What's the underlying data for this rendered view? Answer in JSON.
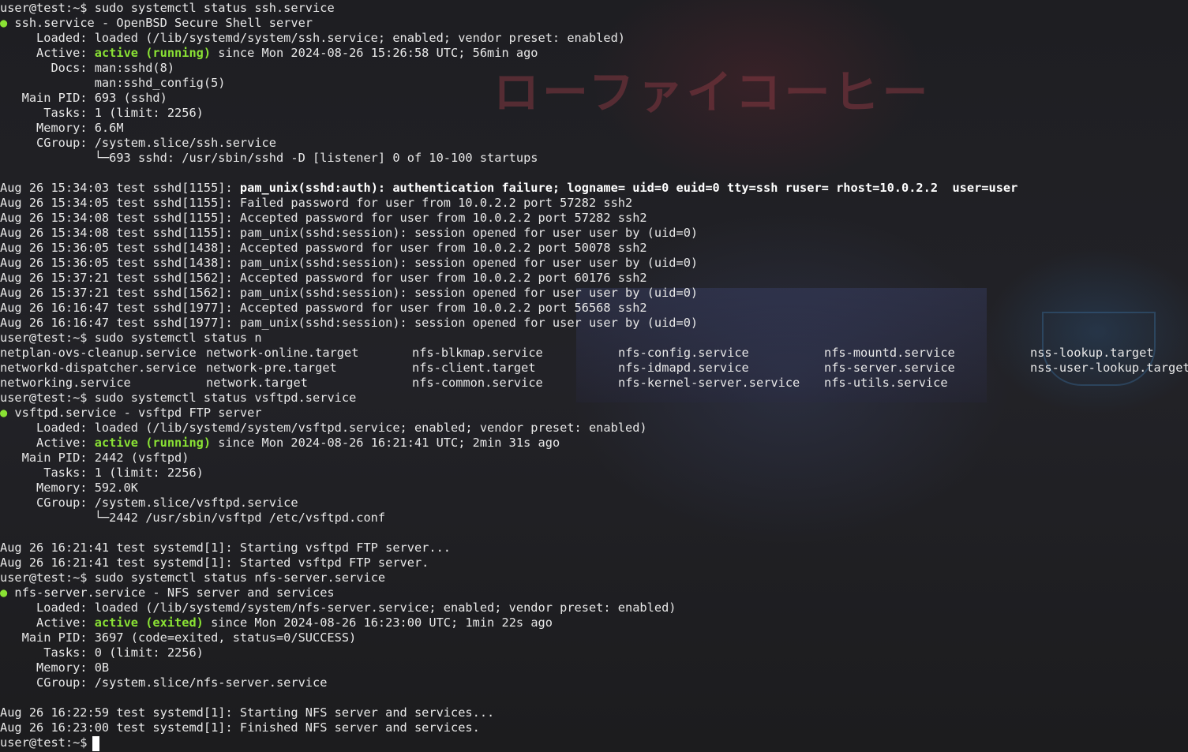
{
  "theme": {
    "bg": "#1f1f1f",
    "text": "#e8e8e8",
    "active": "#8ae234",
    "cursor": "#ffffff"
  },
  "wallpaper": {
    "neon_sign": "ローファイコーヒー"
  },
  "prompt": "user@test:~$ ",
  "commands": {
    "c1": "sudo systemctl status ssh.service",
    "c2": "sudo systemctl status n",
    "c3": "sudo systemctl status vsftpd.service",
    "c4": "sudo systemctl status nfs-server.service"
  },
  "ssh": {
    "dot": "●",
    "header": " ssh.service - OpenBSD Secure Shell server",
    "loaded": "     Loaded: loaded (/lib/systemd/system/ssh.service; enabled; vendor preset: enabled)",
    "active_label": "     Active: ",
    "active_state": "active (running)",
    "active_rest": " since Mon 2024-08-26 15:26:58 UTC; 56min ago",
    "docs1": "       Docs: man:sshd(8)",
    "docs2": "             man:sshd_config(5)",
    "pid": "   Main PID: 693 (sshd)",
    "tasks": "      Tasks: 1 (limit: 2256)",
    "memory": "     Memory: 6.6M",
    "cgroup": "     CGroup: /system.slice/ssh.service",
    "cgroup_child": "             └─693 sshd: /usr/sbin/sshd -D [listener] 0 of 10-100 startups",
    "log_bold": "Aug 26 15:34:03 test sshd[1155]: ",
    "log_bold_msg": "pam_unix(sshd:auth): authentication failure; logname= uid=0 euid=0 tty=ssh ruser= rhost=10.0.2.2  user=user",
    "logs": [
      "Aug 26 15:34:05 test sshd[1155]: Failed password for user from 10.0.2.2 port 57282 ssh2",
      "Aug 26 15:34:08 test sshd[1155]: Accepted password for user from 10.0.2.2 port 57282 ssh2",
      "Aug 26 15:34:08 test sshd[1155]: pam_unix(sshd:session): session opened for user user by (uid=0)",
      "Aug 26 15:36:05 test sshd[1438]: Accepted password for user from 10.0.2.2 port 50078 ssh2",
      "Aug 26 15:36:05 test sshd[1438]: pam_unix(sshd:session): session opened for user user by (uid=0)",
      "Aug 26 15:37:21 test sshd[1562]: Accepted password for user from 10.0.2.2 port 60176 ssh2",
      "Aug 26 15:37:21 test sshd[1562]: pam_unix(sshd:session): session opened for user user by (uid=0)",
      "Aug 26 16:16:47 test sshd[1977]: Accepted password for user from 10.0.2.2 port 56568 ssh2",
      "Aug 26 16:16:47 test sshd[1977]: pam_unix(sshd:session): session opened for user user by (uid=0)"
    ]
  },
  "completions": [
    [
      "netplan-ovs-cleanup.service",
      "network-online.target",
      "nfs-blkmap.service",
      "nfs-config.service",
      "nfs-mountd.service",
      "nss-lookup.target"
    ],
    [
      "networkd-dispatcher.service",
      "network-pre.target",
      "nfs-client.target",
      "nfs-idmapd.service",
      "nfs-server.service",
      "nss-user-lookup.target"
    ],
    [
      "networking.service",
      "network.target",
      "nfs-common.service",
      "nfs-kernel-server.service",
      "nfs-utils.service",
      ""
    ]
  ],
  "vsftpd": {
    "dot": "●",
    "header": " vsftpd.service - vsftpd FTP server",
    "loaded": "     Loaded: loaded (/lib/systemd/system/vsftpd.service; enabled; vendor preset: enabled)",
    "active_label": "     Active: ",
    "active_state": "active (running)",
    "active_rest": " since Mon 2024-08-26 16:21:41 UTC; 2min 31s ago",
    "pid": "   Main PID: 2442 (vsftpd)",
    "tasks": "      Tasks: 1 (limit: 2256)",
    "memory": "     Memory: 592.0K",
    "cgroup": "     CGroup: /system.slice/vsftpd.service",
    "cgroup_child": "             └─2442 /usr/sbin/vsftpd /etc/vsftpd.conf",
    "logs": [
      "Aug 26 16:21:41 test systemd[1]: Starting vsftpd FTP server...",
      "Aug 26 16:21:41 test systemd[1]: Started vsftpd FTP server."
    ]
  },
  "nfs": {
    "dot": "●",
    "header": " nfs-server.service - NFS server and services",
    "loaded": "     Loaded: loaded (/lib/systemd/system/nfs-server.service; enabled; vendor preset: enabled)",
    "active_label": "     Active: ",
    "active_state": "active (exited)",
    "active_rest": " since Mon 2024-08-26 16:23:00 UTC; 1min 22s ago",
    "pid": "   Main PID: 3697 (code=exited, status=0/SUCCESS)",
    "tasks": "      Tasks: 0 (limit: 2256)",
    "memory": "     Memory: 0B",
    "cgroup": "     CGroup: /system.slice/nfs-server.service",
    "logs": [
      "Aug 26 16:22:59 test systemd[1]: Starting NFS server and services...",
      "Aug 26 16:23:00 test systemd[1]: Finished NFS server and services."
    ]
  }
}
